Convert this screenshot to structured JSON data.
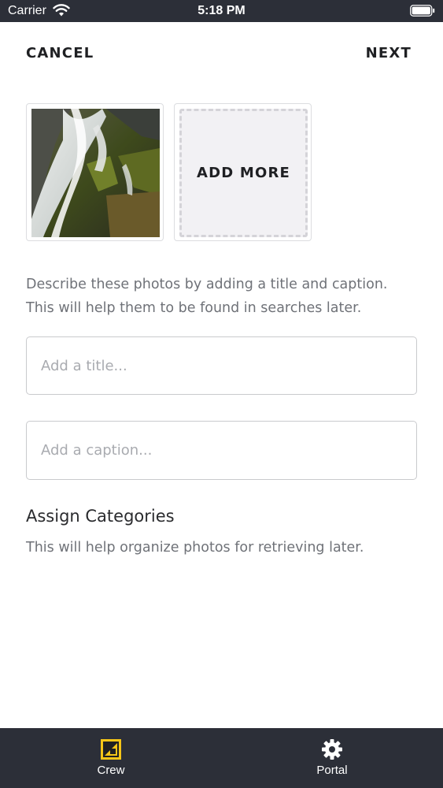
{
  "status_bar": {
    "carrier": "Carrier",
    "time": "5:18 PM"
  },
  "header": {
    "cancel_label": "CANCEL",
    "next_label": "NEXT"
  },
  "photos": {
    "add_more_label": "ADD MORE"
  },
  "description": {
    "text": "Describe these photos by adding a title and caption. This will help them to be found in searches later."
  },
  "inputs": {
    "title_value": "",
    "title_placeholder": "Add a title...",
    "caption_value": "",
    "caption_placeholder": "Add a caption..."
  },
  "categories": {
    "heading": "Assign Categories",
    "description": "This will help organize photos for retrieving later."
  },
  "tab_bar": {
    "tabs": [
      {
        "label": "Crew",
        "icon": "crew-icon",
        "active": true
      },
      {
        "label": "Portal",
        "icon": "gear-icon",
        "active": false
      }
    ]
  },
  "colors": {
    "bars": "#2c2f38",
    "crew_icon": "#f5c518",
    "text_dark": "#1f2023",
    "text_muted": "#6f7278"
  }
}
